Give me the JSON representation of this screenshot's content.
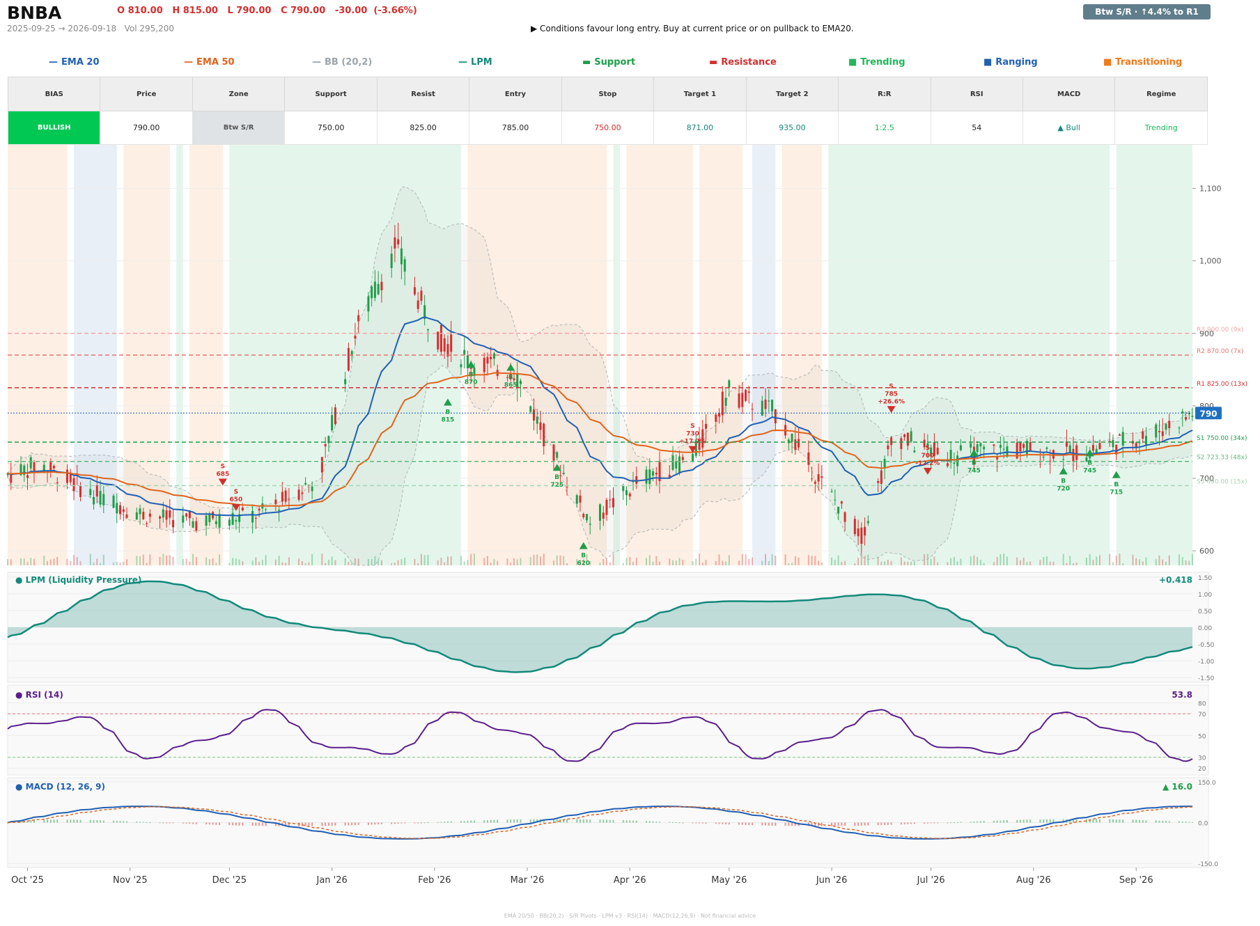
{
  "header": {
    "ticker": "BNBA",
    "ohlc": "O 810.00   H 815.00   L 790.00   C 790.00   -30.00  (-3.66%)",
    "range": "2025-09-25 → 2026-09-18   Vol 295,200",
    "signal": "▶  Conditions favour long entry. Buy at current price or on pullback to EMA20.",
    "zone_badge": "Btw S/R  ·  ↑4.4% to R1"
  },
  "legend": [
    {
      "label": "EMA 20",
      "symbol": "—",
      "color": "#1f5fb4"
    },
    {
      "label": "EMA 50",
      "symbol": "—",
      "color": "#e0641c"
    },
    {
      "label": "BB (20,2)",
      "symbol": "—",
      "color": "#9aa5ac"
    },
    {
      "label": "LPM",
      "symbol": "—",
      "color": "#12897a"
    },
    {
      "label": "Support",
      "symbol": "▬",
      "color": "#1e9e4a"
    },
    {
      "label": "Resistance",
      "symbol": "▬",
      "color": "#d32f2f"
    },
    {
      "label": "Trending",
      "symbol": "■",
      "color": "#1fb85a"
    },
    {
      "label": "Ranging",
      "symbol": "■",
      "color": "#1f5fb4"
    },
    {
      "label": "Transitioning",
      "symbol": "■",
      "color": "#f07a1c"
    }
  ],
  "summary": {
    "headers": [
      "BIAS",
      "Price",
      "Zone",
      "Support",
      "Resist",
      "Entry",
      "Stop",
      "Target 1",
      "Target 2",
      "R:R",
      "RSI",
      "MACD",
      "Regime"
    ],
    "values": [
      "BULLISH",
      "790.00",
      "Btw S/R",
      "750.00",
      "825.00",
      "785.00",
      "750.00",
      "871.00",
      "935.00",
      "1:2.5",
      "54",
      "▲ Bull",
      "Trending"
    ],
    "colors": [
      "#ffffff",
      "#222222",
      "#555555",
      "#222222",
      "#222222",
      "#222222",
      "#d32f2f",
      "#12897a",
      "#12897a",
      "#1fb85a",
      "#222222",
      "#12897a",
      "#1fb85a"
    ],
    "backgrounds": [
      "#00c853",
      "#ffffff",
      "#dfe3e6",
      "#ffffff",
      "#ffffff",
      "#ffffff",
      "#ffffff",
      "#ffffff",
      "#ffffff",
      "#ffffff",
      "#ffffff",
      "#ffffff",
      "#ffffff"
    ]
  },
  "chart_data": {
    "type": "candlestick",
    "price_ylim": [
      580,
      1160
    ],
    "price_ticks": [
      "600",
      "700",
      "800",
      "900",
      "1,000",
      "1,100"
    ],
    "month_labels": [
      "Oct '25",
      "Nov '25",
      "Dec '25",
      "Jan '26",
      "Feb '26",
      "Mar '26",
      "Apr '26",
      "May '26",
      "Jun '26",
      "Jul '26",
      "Aug '26",
      "Sep '26"
    ],
    "month_dates": [
      "2025-10-01",
      "2025-11-01",
      "2025-12-01",
      "2026-01-01",
      "2026-02-01",
      "2026-03-01",
      "2026-04-01",
      "2026-05-01",
      "2026-06-01",
      "2026-07-01",
      "2026-08-01",
      "2026-09-01"
    ],
    "x_range": [
      "2025-09-25",
      "2026-09-18"
    ],
    "last_price": 790,
    "last_price_label": "790",
    "levels": [
      {
        "label": "R3 900.00 (9x)",
        "value": 900,
        "color": "#f2a7a7"
      },
      {
        "label": "R2 870.00 (7x)",
        "value": 870,
        "color": "#e57373"
      },
      {
        "label": "R1 825.00 (13x)",
        "value": 825,
        "color": "#d32f2f"
      },
      {
        "label": "S1 750.00 (34x)",
        "value": 750,
        "color": "#1e9e4a"
      },
      {
        "label": "S2 723.33 (48x)",
        "value": 723.33,
        "color": "#5dbb7a"
      },
      {
        "label": "S3 690.00 (15x)",
        "value": 690,
        "color": "#a5d6b4"
      }
    ],
    "regimes": [
      {
        "start": "2025-09-25",
        "end": "2025-10-13",
        "type": "Transitioning"
      },
      {
        "start": "2025-10-15",
        "end": "2025-10-28",
        "type": "Ranging"
      },
      {
        "start": "2025-10-30",
        "end": "2025-11-13",
        "type": "Transitioning"
      },
      {
        "start": "2025-11-15",
        "end": "2025-11-17",
        "type": "Trending"
      },
      {
        "start": "2025-11-19",
        "end": "2025-11-29",
        "type": "Transitioning"
      },
      {
        "start": "2025-12-01",
        "end": "2026-02-09",
        "type": "Trending"
      },
      {
        "start": "2026-02-11",
        "end": "2026-03-25",
        "type": "Transitioning"
      },
      {
        "start": "2026-03-27",
        "end": "2026-03-29",
        "type": "Trending"
      },
      {
        "start": "2026-03-31",
        "end": "2026-04-20",
        "type": "Transitioning"
      },
      {
        "start": "2026-04-22",
        "end": "2026-05-05",
        "type": "Transitioning"
      },
      {
        "start": "2026-05-08",
        "end": "2026-05-15",
        "type": "Ranging"
      },
      {
        "start": "2026-05-17",
        "end": "2026-05-29",
        "type": "Transitioning"
      },
      {
        "start": "2026-05-31",
        "end": "2026-08-24",
        "type": "Trending"
      },
      {
        "start": "2026-08-26",
        "end": "2026-09-18",
        "type": "Trending"
      }
    ],
    "trades": [
      {
        "type": "S",
        "date": "2025-11-29",
        "label": "S\n685",
        "price": 690
      },
      {
        "type": "S",
        "date": "2025-12-03",
        "label": "S\n650",
        "price": 655
      },
      {
        "type": "B",
        "date": "2026-02-05",
        "label": "B\n815",
        "price": 810
      },
      {
        "type": "B",
        "date": "2026-02-12",
        "label": "B\n870",
        "price": 862
      },
      {
        "type": "B",
        "date": "2026-02-24",
        "label": "B\n865",
        "price": 858
      },
      {
        "type": "B",
        "date": "2026-03-10",
        "label": "B\n725",
        "price": 720
      },
      {
        "type": "B",
        "date": "2026-03-18",
        "label": "B\n620",
        "price": 612
      },
      {
        "type": "S",
        "date": "2026-04-20",
        "label": "S\n730\n+17.7%",
        "price": 735
      },
      {
        "type": "S",
        "date": "2026-06-19",
        "label": "S\n785\n+26.6%",
        "price": 790
      },
      {
        "type": "S",
        "date": "2026-06-30",
        "label": "S\n700\n-12.2%",
        "price": 705
      },
      {
        "type": "B",
        "date": "2026-07-14",
        "label": "B\n745",
        "price": 740
      },
      {
        "type": "B",
        "date": "2026-08-10",
        "label": "B\n720",
        "price": 715
      },
      {
        "type": "B",
        "date": "2026-08-18",
        "label": "B\n745",
        "price": 740
      },
      {
        "type": "B",
        "date": "2026-08-26",
        "label": "B\n715",
        "price": 710
      }
    ],
    "lpm": {
      "title": "● LPM (Liquidity Pressure)",
      "value": "+0.418",
      "ylim": [
        -1.6,
        1.6
      ],
      "ticks": [
        "1.50",
        "1.00",
        "0.50",
        "0.00",
        "-0.50",
        "-1.00",
        "-1.50"
      ]
    },
    "rsi": {
      "title": "● RSI (14)",
      "value": "53.8",
      "ylim": [
        15,
        95
      ],
      "ticks": [
        "80",
        "70",
        "50",
        "30",
        "20"
      ]
    },
    "macd": {
      "title": "● MACD (12, 26, 9)",
      "value": "▲ 16.0",
      "ylim": [
        -160,
        160
      ],
      "ticks": [
        "150.0",
        "0.0",
        "-150.0"
      ]
    }
  },
  "footer": "EMA 20/50  ·  BB(20,2)  ·  S/R Pivots  ·  LPM v3  ·  RSI(14)  ·  MACD(12,26,9)  ·  Not financial advice"
}
